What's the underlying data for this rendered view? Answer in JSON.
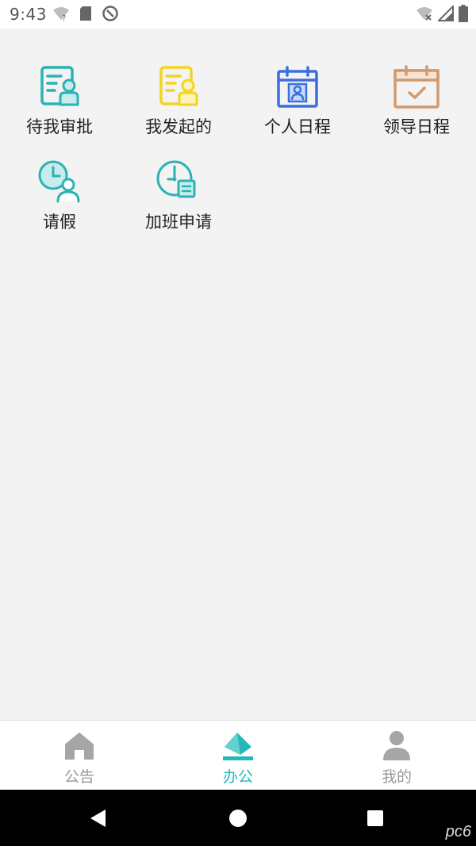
{
  "status_bar": {
    "time": "9:43"
  },
  "apps": [
    {
      "label": "待我审批",
      "icon": "document-approval-icon",
      "color": "#2bb2b5"
    },
    {
      "label": "我发起的",
      "icon": "document-initiated-icon",
      "color": "#f2d520"
    },
    {
      "label": "个人日程",
      "icon": "calendar-person-icon",
      "color": "#3b6fe0"
    },
    {
      "label": "领导日程",
      "icon": "calendar-check-icon",
      "color": "#d09a6e"
    },
    {
      "label": "请假",
      "icon": "clock-person-icon",
      "color": "#2bb2b5"
    },
    {
      "label": "加班申请",
      "icon": "clock-document-icon",
      "color": "#2bb2b5"
    }
  ],
  "tabs": [
    {
      "label": "公告",
      "icon": "home-icon",
      "active": false
    },
    {
      "label": "办公",
      "icon": "office-icon",
      "active": true
    },
    {
      "label": "我的",
      "icon": "user-icon",
      "active": false
    }
  ],
  "colors": {
    "accent": "#25b7b9",
    "inactive": "#999999",
    "background": "#f3f3f3"
  }
}
